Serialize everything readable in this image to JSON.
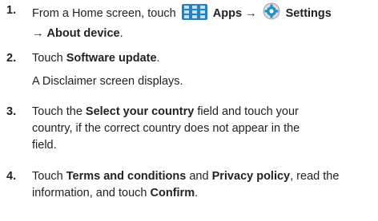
{
  "steps": [
    {
      "number": "1.",
      "line1_prefix": "From a Home screen, touch",
      "apps": "Apps",
      "arrow": "→",
      "settings": "Settings",
      "apps_icon": "apps-grid-icon",
      "settings_icon": "settings-gear-icon",
      "line2_arrow": "→",
      "line2_bold": "About device",
      "line2_end": "."
    },
    {
      "number": "2.",
      "pre": "Touch",
      "bold": "Software update",
      "end": ".",
      "note": "A Disclaimer screen displays."
    },
    {
      "number": "3.",
      "pre": "Touch the",
      "bold": "Select your country",
      "post1": "field and touch your",
      "line2": "country, if the correct country does not appear in the",
      "line3": "field."
    },
    {
      "number": "4.",
      "pre": "Touch",
      "bold1": "Terms and conditions",
      "mid": "and",
      "bold2": "Privacy policy",
      "post": ", read the",
      "line2_pre": "information, and touch",
      "line2_bold": "Confirm",
      "line2_end": "."
    }
  ],
  "colors": {
    "text": "#222222",
    "apps_icon": "#2a7fc1",
    "settings_icon": "#1f8fc7"
  }
}
